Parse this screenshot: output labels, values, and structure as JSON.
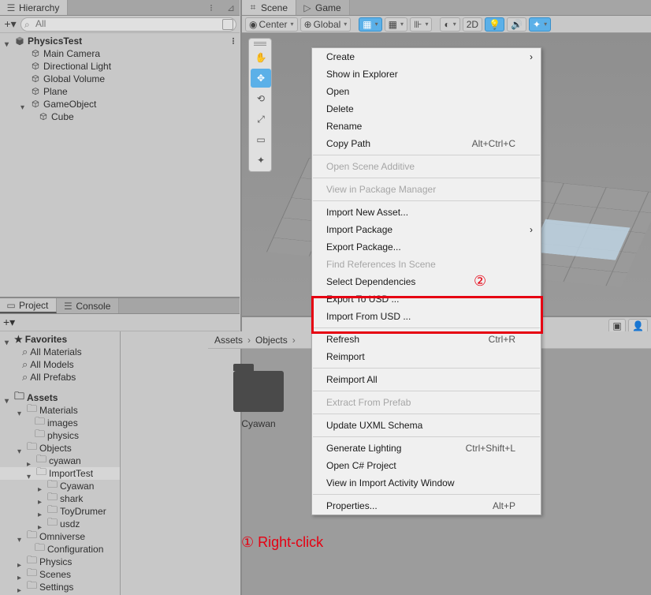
{
  "hierarchy": {
    "tab": "Hierarchy",
    "search_placeholder": "All",
    "root": "PhysicsTest",
    "items": [
      "Main Camera",
      "Directional Light",
      "Global Volume",
      "Plane"
    ],
    "gameObject": "GameObject",
    "cube": "Cube"
  },
  "project": {
    "tabs": [
      "Project",
      "Console"
    ],
    "favorites": "Favorites",
    "fav_items": [
      "All Materials",
      "All Models",
      "All Prefabs"
    ],
    "assets": "Assets",
    "tree": {
      "materials": "Materials",
      "images": "images",
      "physics": "physics",
      "objects": "Objects",
      "cyawan": "cyawan",
      "importTest": "ImportTest",
      "it_children": [
        "Cyawan",
        "shark",
        "ToyDrumer",
        "usdz"
      ],
      "omniverse": "Omniverse",
      "config": "Configuration",
      "physics2": "Physics",
      "scenes": "Scenes",
      "settings": "Settings"
    },
    "breadcrumb": [
      "Assets",
      "Objects"
    ],
    "folder_label": "Cyawan"
  },
  "scene": {
    "tabs": [
      "Scene",
      "Game"
    ],
    "pivot": "Center",
    "space": "Global",
    "mode2d": "2D"
  },
  "context_menu": {
    "items": [
      {
        "label": "Create",
        "sub": true
      },
      {
        "label": "Show in Explorer"
      },
      {
        "label": "Open"
      },
      {
        "label": "Delete"
      },
      {
        "label": "Rename"
      },
      {
        "label": "Copy Path",
        "shortcut": "Alt+Ctrl+C"
      },
      {
        "sep": true
      },
      {
        "label": "Open Scene Additive",
        "disabled": true
      },
      {
        "sep": true
      },
      {
        "label": "View in Package Manager",
        "disabled": true
      },
      {
        "sep": true
      },
      {
        "label": "Import New Asset..."
      },
      {
        "label": "Import Package",
        "sub": true
      },
      {
        "label": "Export Package..."
      },
      {
        "label": "Find References In Scene",
        "disabled": true
      },
      {
        "label": "Select Dependencies"
      },
      {
        "label": "Export To USD ..."
      },
      {
        "label": "Import From USD ..."
      },
      {
        "sep": true
      },
      {
        "label": "Refresh",
        "shortcut": "Ctrl+R"
      },
      {
        "label": "Reimport"
      },
      {
        "sep": true
      },
      {
        "label": "Reimport All"
      },
      {
        "sep": true
      },
      {
        "label": "Extract From Prefab",
        "disabled": true
      },
      {
        "sep": true
      },
      {
        "label": "Update UXML Schema"
      },
      {
        "sep": true
      },
      {
        "label": "Generate Lighting",
        "shortcut": "Ctrl+Shift+L"
      },
      {
        "label": "Open C# Project"
      },
      {
        "label": "View in Import Activity Window"
      },
      {
        "sep": true
      },
      {
        "label": "Properties...",
        "shortcut": "Alt+P"
      }
    ]
  },
  "annotations": {
    "a1": "① Right-click",
    "a2": "②"
  }
}
